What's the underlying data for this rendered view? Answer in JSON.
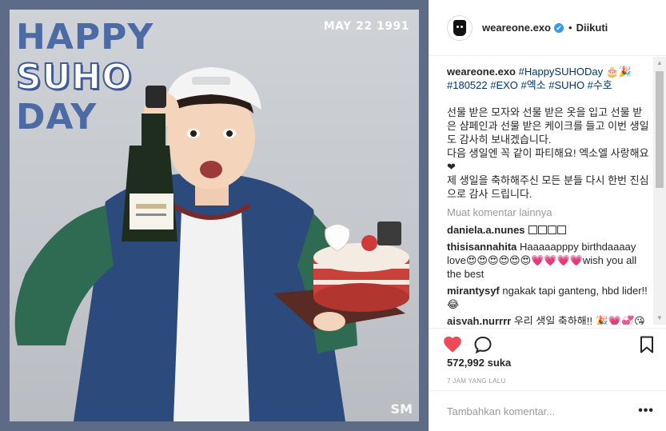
{
  "image": {
    "headline_line1": "HAPPY",
    "headline_line2": "SUHO",
    "headline_line3": "DAY",
    "date": "MAY 22 1991",
    "watermark": "SM"
  },
  "header": {
    "username": "weareone.exo",
    "verified_icon": "✔",
    "separator": "•",
    "follow_state": "Diikuti"
  },
  "caption": {
    "username": "weareone.exo",
    "tags_line1": "#HappySUHODay 🎂🎉",
    "tags_line2": "#180522 #EXO #엑소 #SUHO #수호",
    "body": "선물 받은 모자와 선물 받은 옷을 입고 선물 받은 샴페인과 선물 받은 케이크를 들고 이번 생일도 감사히 보내겠습니다.\n다음 생일엔 꼭 같이 파티해요! 엑소엘 사랑해요❤\n제 생일을 축하해주신 모든 분들 다시 한번 진심으로 감사 드립니다."
  },
  "comments": {
    "more_label": "Muat komentar lainnya",
    "items": [
      {
        "user": "daniela.a.nunes",
        "text": ""
      },
      {
        "user": "thisisannahita",
        "text": "Haaaaapppy birthdaaaay love😍😍😍😍😍😍💗💗💗💗wish you all the best"
      },
      {
        "user": "mirantysyf",
        "text": "ngakak tapi ganteng, hbd lider!!😂"
      },
      {
        "user": "aisyah.nurrrr",
        "text": "우리 생일 축하해!! 🎉💗💞😘"
      }
    ]
  },
  "actions": {
    "heart_color": "#ed4956",
    "likes": "572,992 suka",
    "timestamp": "7 JAM YANG LALU"
  },
  "composer": {
    "placeholder": "Tambahkan komentar...",
    "more_label": "•••"
  },
  "colors": {
    "frame": "#5d6b86",
    "headline_blue": "#4c6aa4",
    "hashtag": "#003569",
    "muted": "#999999"
  }
}
